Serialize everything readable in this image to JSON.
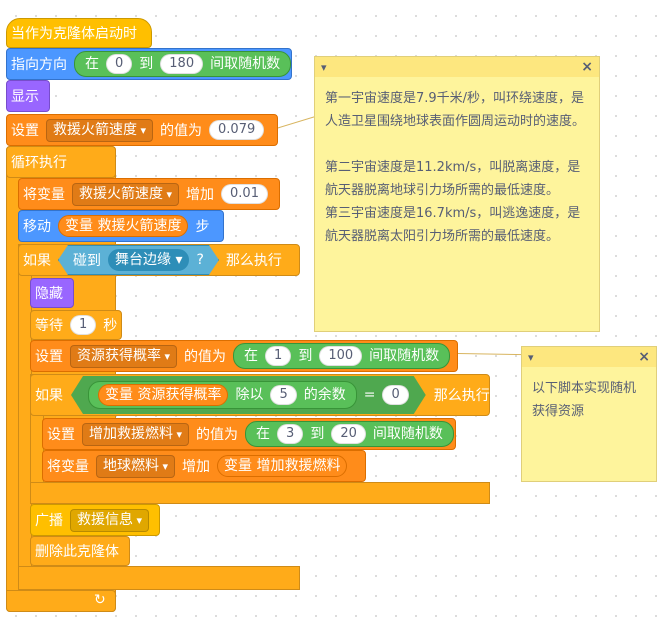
{
  "script": {
    "hat_label": "当作为克隆体启动时",
    "point_label": "指向方向",
    "point_random_prefix": "在",
    "point_random_min": "0",
    "point_random_mid": "到",
    "point_random_max": "180",
    "point_random_suffix": "间取随机数",
    "show_label": "显示",
    "set_prefix": "设置",
    "set_var": "救援火箭速度",
    "set_to": "的值为",
    "set_value": "0.079",
    "forever_label": "循环执行",
    "change_prefix": "将变量",
    "change_var": "救援火箭速度",
    "change_by": "增加",
    "change_value": "0.01",
    "move_label": "移动",
    "move_reporter": "变量 救援火箭速度",
    "move_suffix": "步",
    "if1_label": "如果",
    "touch_label": "碰到",
    "touch_target": "舞台边缘",
    "touch_q": "?",
    "then_label": "那么执行",
    "hide_label": "隐藏",
    "wait_label": "等待",
    "wait_value": "1",
    "wait_unit": "秒",
    "set2_prefix": "设置",
    "set2_var": "资源获得概率",
    "set2_to": "的值为",
    "set2_rand_prefix": "在",
    "set2_rand_min": "1",
    "set2_rand_mid": "到",
    "set2_rand_max": "100",
    "set2_rand_suffix": "间取随机数",
    "if2_label": "如果",
    "mod_reporter": "变量 资源获得概率",
    "mod_label": "除以",
    "mod_value": "5",
    "mod_suffix": "的余数",
    "eq_label": "=",
    "eq_value": "0",
    "then2_label": "那么执行",
    "set3_prefix": "设置",
    "set3_var": "增加救援燃料",
    "set3_to": "的值为",
    "set3_rand_prefix": "在",
    "set3_rand_min": "3",
    "set3_rand_mid": "到",
    "set3_rand_max": "20",
    "set3_rand_suffix": "间取随机数",
    "change2_prefix": "将变量",
    "change2_var": "地球燃料",
    "change2_by": "增加",
    "change2_reporter": "变量 增加救援燃料",
    "broadcast_label": "广播",
    "broadcast_msg": "救援信息",
    "delete_label": "删除此克隆体",
    "loop_arrow": "↻"
  },
  "notes": [
    {
      "collapse": "▾",
      "close": "×",
      "text": "第一宇宙速度是7.9千米/秒，叫环绕速度，是人造卫星围绕地球表面作圆周运动时的速度。\n\n第二宇宙速度是11.2km/s，叫脱离速度，是航天器脱离地球引力场所需的最低速度。\n第三宇宙速度是16.7km/s，叫逃逸速度，是航天器脱离太阳引力场所需的最低速度。"
    },
    {
      "collapse": "▾",
      "close": "×",
      "text": "以下脚本实现随机获得资源"
    }
  ],
  "colors": {
    "control": "#ffab19",
    "events": "#ffbf00",
    "variables": "#ff8c1a",
    "motion": "#4c97ff",
    "looks": "#9966ff",
    "operators": "#59c059",
    "sensing": "#5cb1d6",
    "note": "#fef49c"
  }
}
